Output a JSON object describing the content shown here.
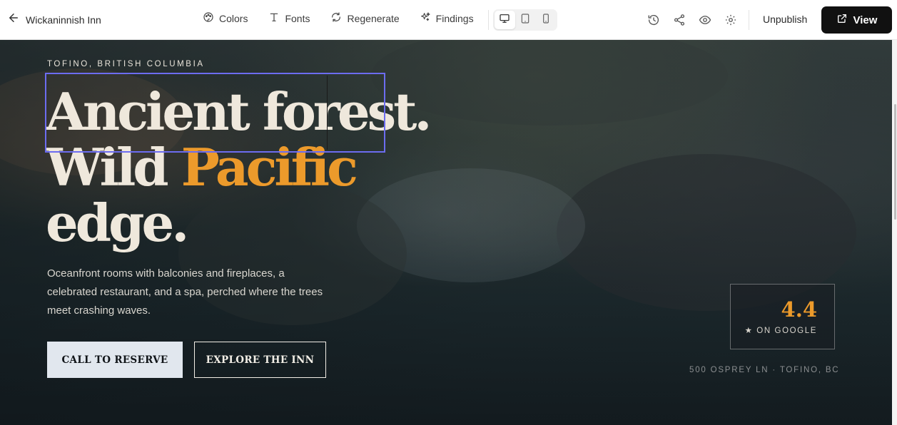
{
  "toolbar": {
    "back_icon": "arrow-left-icon",
    "site_name": "Wickaninnish Inn",
    "tools": {
      "colors": {
        "label": "Colors",
        "icon": "palette-icon"
      },
      "fonts": {
        "label": "Fonts",
        "icon": "type-icon"
      },
      "regenerate": {
        "label": "Regenerate",
        "icon": "refresh-icon"
      },
      "findings": {
        "label": "Findings",
        "icon": "sparkles-icon"
      }
    },
    "devices": {
      "selected": "desktop",
      "options": [
        "desktop",
        "tablet",
        "mobile"
      ]
    },
    "actions": [
      "history-icon",
      "share-icon",
      "eye-icon",
      "gear-icon"
    ],
    "unpublish_label": "Unpublish",
    "view_label": "View"
  },
  "hero": {
    "eyebrow": "TOFINO, BRITISH COLUMBIA",
    "headline": {
      "line1": "Ancient forest.",
      "line2_plain": "Wild ",
      "line2_accent": "Pacific",
      "line3": "edge."
    },
    "description": "Oceanfront rooms with balconies and fireplaces, a celebrated restaurant, and a spa, perched where the trees meet crashing waves.",
    "primary_cta": "CALL TO RESERVE",
    "secondary_cta": "EXPLORE THE INN",
    "rating": {
      "score": "4.4",
      "source": "★ ON GOOGLE"
    },
    "address": "500 OSPREY LN · TOFINO, BC"
  },
  "colors": {
    "accent": "#ec9a2b",
    "headline": "#efe8dc",
    "selection": "#6c6cf0",
    "view_button": "#111111"
  }
}
